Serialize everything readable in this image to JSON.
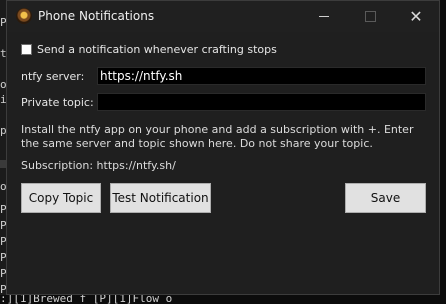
{
  "window": {
    "title": "Phone Notifications"
  },
  "notify_checkbox": {
    "label": "Send a notification whenever crafting stops",
    "checked": false
  },
  "fields": {
    "server_label": "ntfy server:",
    "server_value": "https://ntfy.sh",
    "topic_label": "Private topic:",
    "topic_value": ""
  },
  "info_text": "Install the ntfy app on your phone and add a subscription with +. Enter the same server and topic shown here. Do not share your topic.",
  "subscription_text": "Subscription: https://ntfy.sh/",
  "buttons": {
    "copy_topic": "Copy Topic",
    "test_notification": "Test Notification",
    "save": "Save"
  },
  "background_console": {
    "fragments": [
      "P",
      "ta",
      "o",
      "ir",
      "p",
      "ou",
      "P]",
      "P]",
      "P]",
      "P]",
      "P]",
      "P]"
    ],
    "bottom_line": ":][1]Brewed f [P][1]Flow o"
  }
}
